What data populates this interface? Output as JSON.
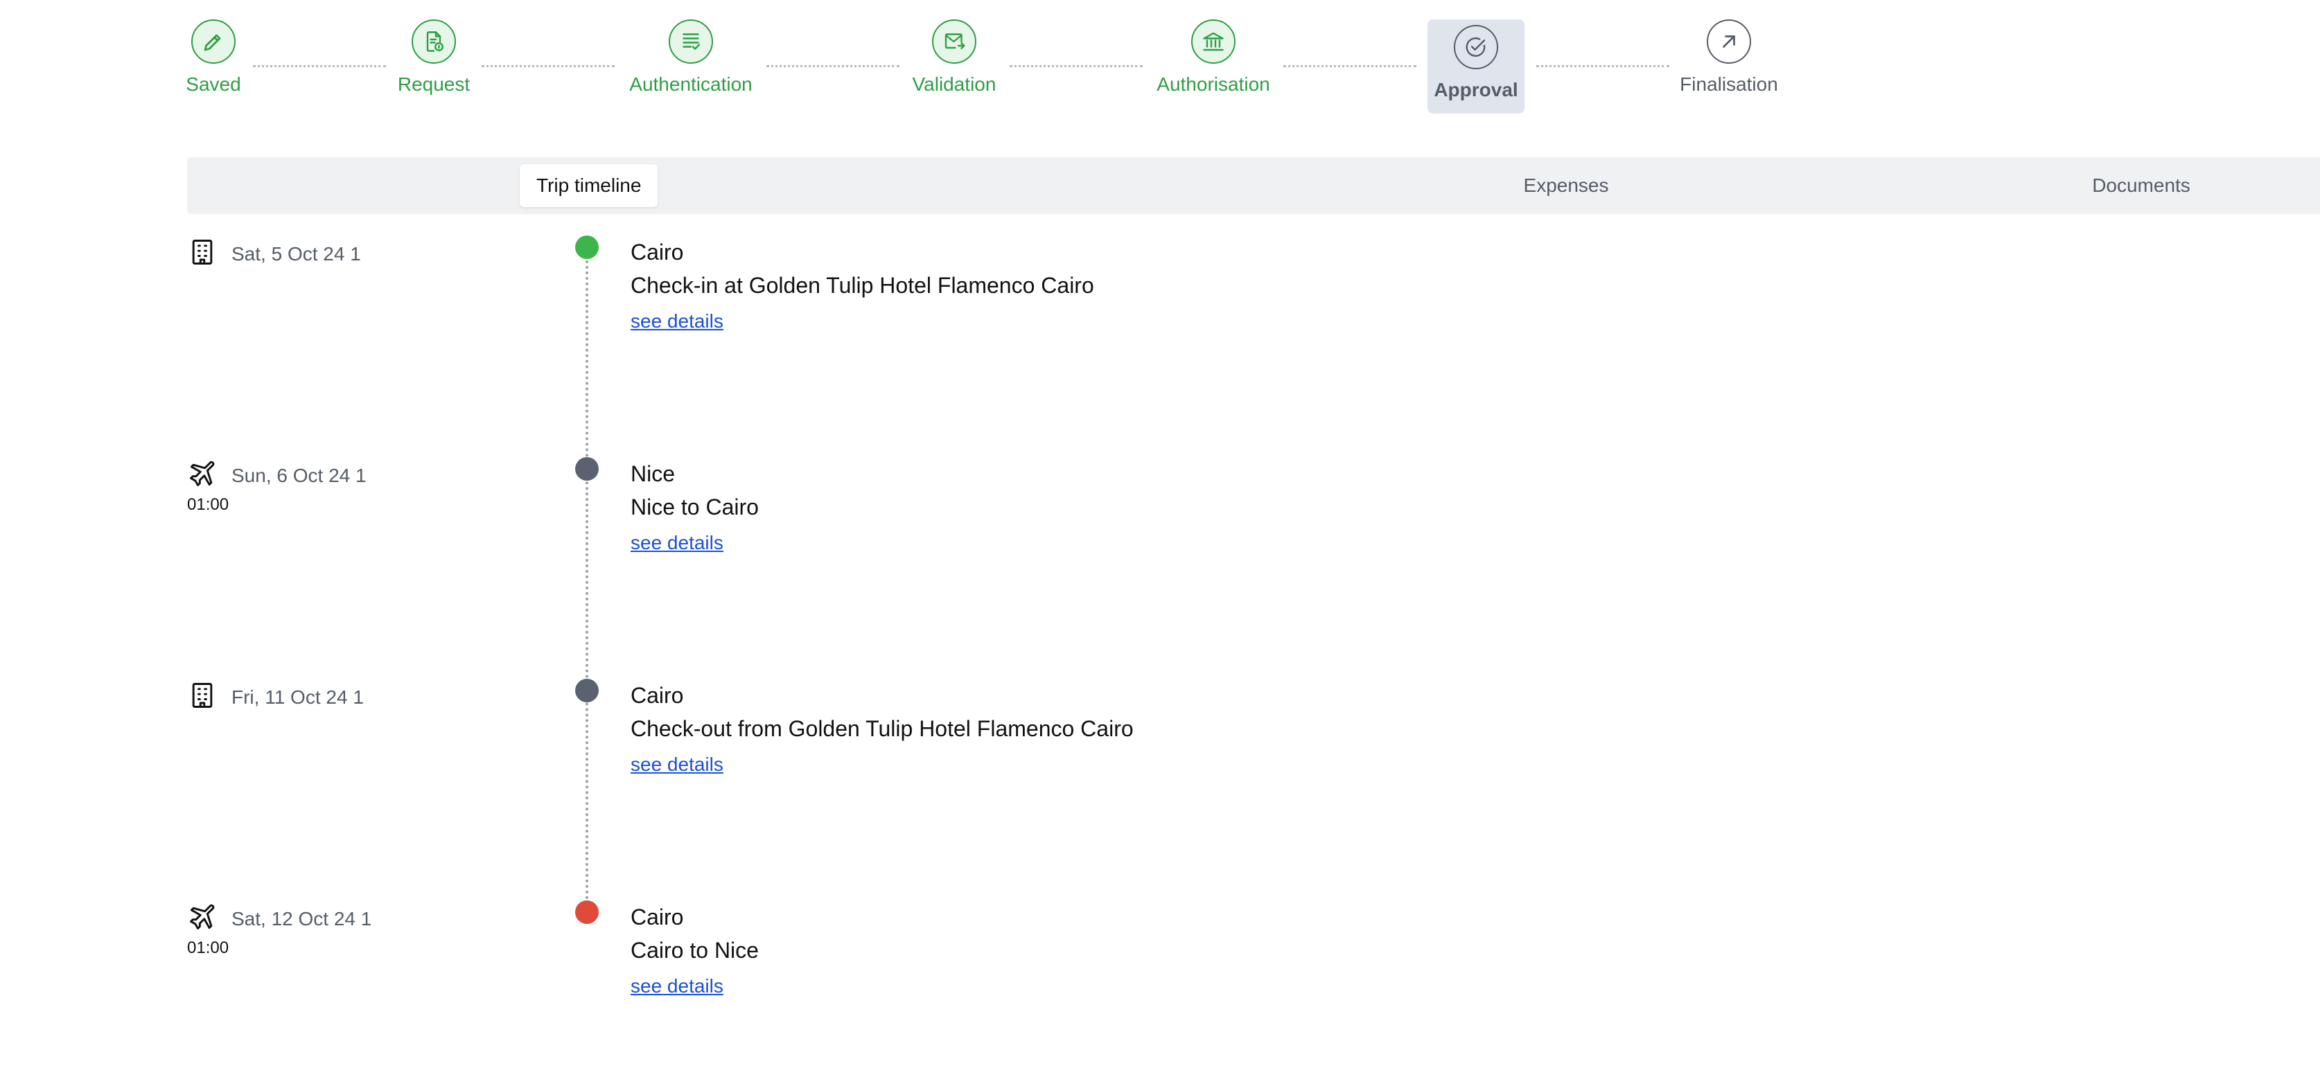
{
  "stepper": {
    "steps": [
      {
        "label": "Saved",
        "icon": "pencil-icon",
        "state": "done"
      },
      {
        "label": "Request",
        "icon": "document-info-icon",
        "state": "done"
      },
      {
        "label": "Authentication",
        "icon": "checklist-icon",
        "state": "done"
      },
      {
        "label": "Validation",
        "icon": "mail-forward-icon",
        "state": "done"
      },
      {
        "label": "Authorisation",
        "icon": "bank-icon",
        "state": "done"
      },
      {
        "label": "Approval",
        "icon": "check-circle-icon",
        "state": "current"
      },
      {
        "label": "Finalisation",
        "icon": "arrow-up-right-icon",
        "state": "pending"
      }
    ],
    "colors": {
      "done": "#2e9e44",
      "current": "#555c66",
      "pending": "#555c66"
    }
  },
  "tabs": {
    "items": [
      {
        "label": "Trip timeline",
        "active": true
      },
      {
        "label": "Expenses",
        "active": false
      },
      {
        "label": "Documents",
        "active": false
      }
    ]
  },
  "timeline": {
    "events": [
      {
        "icon": "building-icon",
        "date": "Sat, 5 Oct 24 1",
        "time": "",
        "city": "Cairo",
        "description": "Check-in at Golden Tulip Hotel Flamenco Cairo",
        "link": "see details",
        "dot_color": "#3cb54a"
      },
      {
        "icon": "airplane-icon",
        "date": "Sun, 6 Oct 24 1",
        "time": "01:00",
        "city": "Nice",
        "description": "Nice to Cairo",
        "link": "see details",
        "dot_color": "#5a6270"
      },
      {
        "icon": "building-icon",
        "date": "Fri, 11 Oct 24 1",
        "time": "",
        "city": "Cairo",
        "description": "Check-out from Golden Tulip Hotel Flamenco Cairo",
        "link": "see details",
        "dot_color": "#5a6270"
      },
      {
        "icon": "airplane-icon",
        "date": "Sat, 12 Oct 24 1",
        "time": "01:00",
        "city": "Cairo",
        "description": "Cairo to Nice",
        "link": "see details",
        "dot_color": "#e04a3a"
      }
    ]
  }
}
